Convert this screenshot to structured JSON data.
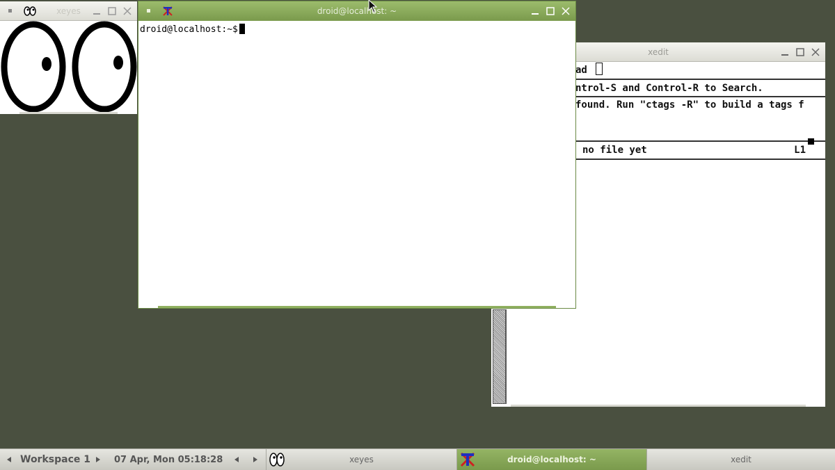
{
  "windows": {
    "xeyes": {
      "title": "xeyes"
    },
    "terminal": {
      "title": "droid@localhost: ~",
      "prompt": "droid@localhost:~$"
    },
    "xedit": {
      "title": "xedit",
      "filename_field": "ad",
      "messages": [
        "ntrol-S and Control-R to Search.",
        "found. Run \"ctags -R\" to build a tags f"
      ],
      "status": "no file yet",
      "line": "L1"
    }
  },
  "taskbar": {
    "workspace": "Workspace 1",
    "clock": "07 Apr, Mon 05:18:28",
    "tasks": [
      {
        "label": "xeyes",
        "active": false
      },
      {
        "label": "droid@localhost: ~",
        "active": true
      },
      {
        "label": "xedit",
        "active": false
      }
    ]
  },
  "colors": {
    "desktop": "#4a5040",
    "active_title": "#7a9a4c",
    "inactive_title": "#dcdcd4"
  }
}
